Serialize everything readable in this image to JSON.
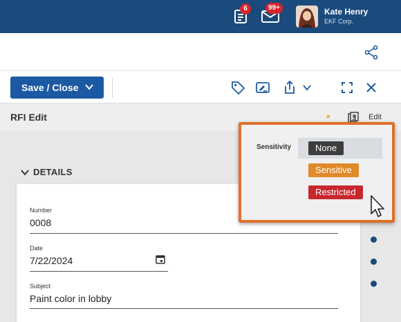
{
  "header": {
    "notifications_count": "6",
    "messages_count": "99+",
    "user_name": "Kate Henry",
    "user_org": "EKF Corp.",
    "icons": [
      "clipboard-list-icon",
      "envelope-icon",
      "share-icon"
    ]
  },
  "toolbar": {
    "save_label": "Save / Close",
    "icons": [
      "tag-icon",
      "sign-icon",
      "export-icon",
      "expand-icon",
      "close-icon"
    ]
  },
  "page": {
    "title": "RFI Edit",
    "required_marker": "*",
    "edit_label": "Edit"
  },
  "details": {
    "section_label": "DETAILS",
    "fields": [
      {
        "label": "Number",
        "value": "0008"
      },
      {
        "label": "Date",
        "value": "7/22/2024"
      },
      {
        "label": "Subject",
        "value": "Paint color in lobby"
      }
    ]
  },
  "sensitivity": {
    "label": "Sensitivity",
    "options": [
      {
        "label": "None",
        "color": "#3d3d3d"
      },
      {
        "label": "Sensitive",
        "color": "#e08a2a"
      },
      {
        "label": "Restricted",
        "color": "#c8272d"
      }
    ]
  },
  "colors": {
    "header_bg": "#1b4a7c",
    "primary_button": "#1b5aa3",
    "highlight_frame": "#e0702a"
  }
}
